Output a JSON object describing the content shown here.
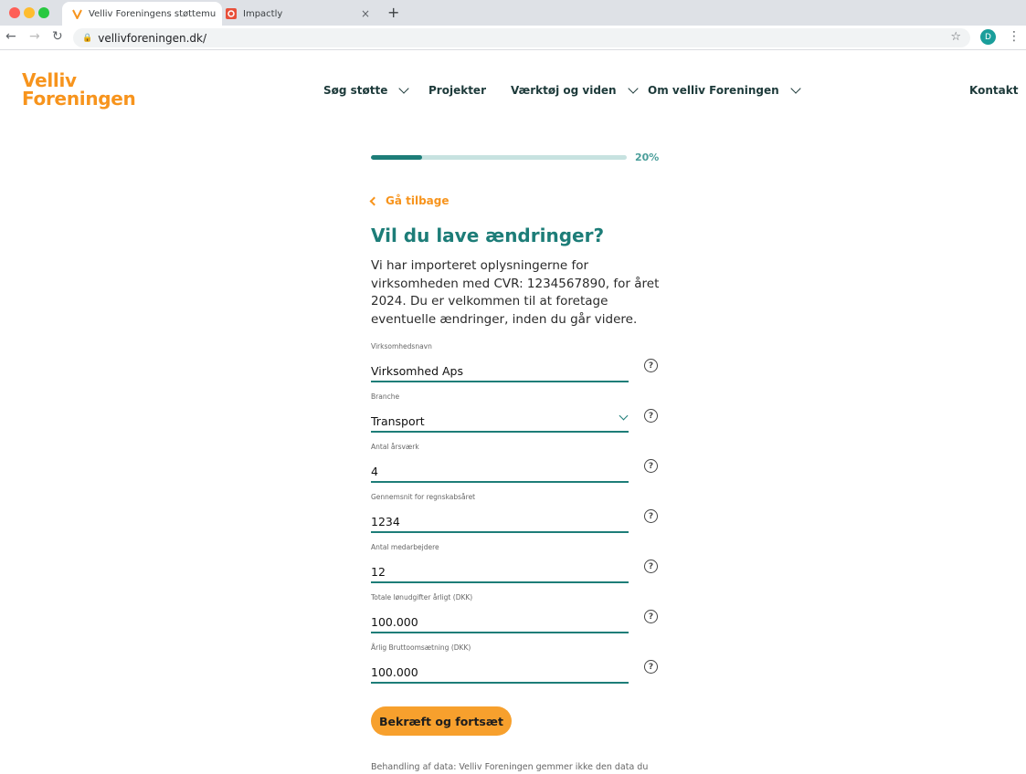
{
  "browser": {
    "tabs": [
      {
        "title": "Velliv Foreningens støttemuligh"
      },
      {
        "title": "Impactly"
      }
    ],
    "tab_close": "×",
    "new_tab": "+",
    "url": "vellivforeningen.dk/",
    "profile_initial": "D",
    "traffic_colors": [
      "#fe5f57",
      "#febc2e",
      "#28c840"
    ]
  },
  "header": {
    "logo_line1": "Velliv",
    "logo_line2": "Foreningen",
    "nav": [
      {
        "label": "Søg støtte",
        "has_dropdown": true
      },
      {
        "label": "Projekter",
        "has_dropdown": false
      },
      {
        "label": "Værktøj og viden",
        "has_dropdown": true
      },
      {
        "label": "Om velliv Foreningen",
        "has_dropdown": true
      }
    ],
    "contact": "Kontakt"
  },
  "progress": {
    "value": 0.2,
    "label": "20%"
  },
  "back_label": "Gå tilbage",
  "title": "Vil du lave ændringer?",
  "intro": "Vi har importeret oplysningerne for virksomheden med CVR: 1234567890, for året 2024. Du er velkommen til at foretage eventuelle ændringer, inden du går videre.",
  "fields": [
    {
      "label": "Virksomhedsnavn",
      "value": "Virksomhed Aps"
    },
    {
      "label": "Branche",
      "value": "Transport",
      "type": "select"
    },
    {
      "label": "Antal årsværk",
      "value": "4"
    },
    {
      "label": "Gennemsnit for regnskabsåret",
      "value": "1234"
    },
    {
      "label": "Antal medarbejdere",
      "value": "12"
    },
    {
      "label": "Totale lønudgifter årligt (DKK)",
      "value": "100.000"
    },
    {
      "label": "Årlig Bruttoomsætning (DKK)",
      "value": "100.000"
    }
  ],
  "help_glyph": "?",
  "cta_label": "Bekræft og fortsæt",
  "footnote": "Behandling af data: Velliv Foreningen gemmer ikke den data du",
  "colors": {
    "brand_orange": "#f7941d",
    "brand_teal": "#1d7d78",
    "cta": "#f7a02d"
  }
}
